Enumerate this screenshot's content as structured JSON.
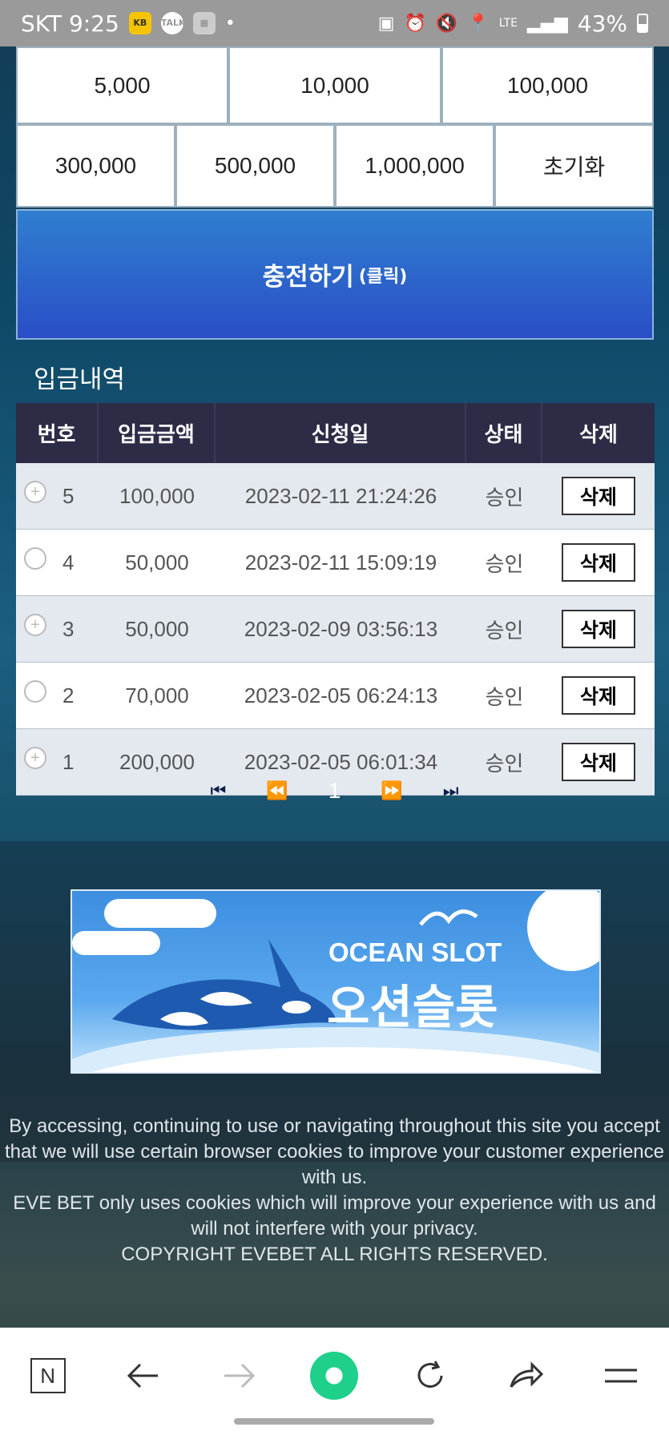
{
  "status_bar": {
    "carrier_time": "SKT 9:25",
    "icons": [
      "kb-icon",
      "talk-icon",
      "app-icon"
    ],
    "dot": "•",
    "battery": "43%",
    "network": "LTE"
  },
  "amounts": {
    "row1": [
      "5,000",
      "10,000",
      "100,000"
    ],
    "row2": [
      "300,000",
      "500,000",
      "1,000,000",
      "초기화"
    ]
  },
  "charge_button": {
    "label": "충전하기",
    "sub": "(클릭)"
  },
  "section_title": "입금내역",
  "table": {
    "headers": [
      "번호",
      "입금금액",
      "신청일",
      "상태",
      "삭제"
    ],
    "rows": [
      {
        "no": "5",
        "amount": "100,000",
        "date": "2023-02-11 21:24:26",
        "status": "승인",
        "delete": "삭제"
      },
      {
        "no": "4",
        "amount": "50,000",
        "date": "2023-02-11 15:09:19",
        "status": "승인",
        "delete": "삭제"
      },
      {
        "no": "3",
        "amount": "50,000",
        "date": "2023-02-09 03:56:13",
        "status": "승인",
        "delete": "삭제"
      },
      {
        "no": "2",
        "amount": "70,000",
        "date": "2023-02-05 06:24:13",
        "status": "승인",
        "delete": "삭제"
      },
      {
        "no": "1",
        "amount": "200,000",
        "date": "2023-02-05 06:01:34",
        "status": "승인",
        "delete": "삭제"
      }
    ]
  },
  "pager": {
    "first": "⏮",
    "prev": "⏪",
    "current": "1",
    "next": "⏩",
    "last": "⏭"
  },
  "banner": {
    "title_en": "OCEAN SLOT",
    "title_ko": "오션슬롯"
  },
  "footer": {
    "line1": "By accessing, continuing to use or navigating throughout this site you accept that we will use certain browser cookies to improve your customer experience with us.",
    "line2": "EVE BET only uses cookies which will improve your experience with us and will not interfere with your privacy.",
    "line3": "COPYRIGHT EVEBET ALL RIGHTS RESERVED."
  },
  "nav": {
    "n_label": "N"
  },
  "colors": {
    "header_bg": "#2d2c47",
    "charge_bg": "#2a4ec6",
    "row_shade": "#e4e9f0"
  }
}
